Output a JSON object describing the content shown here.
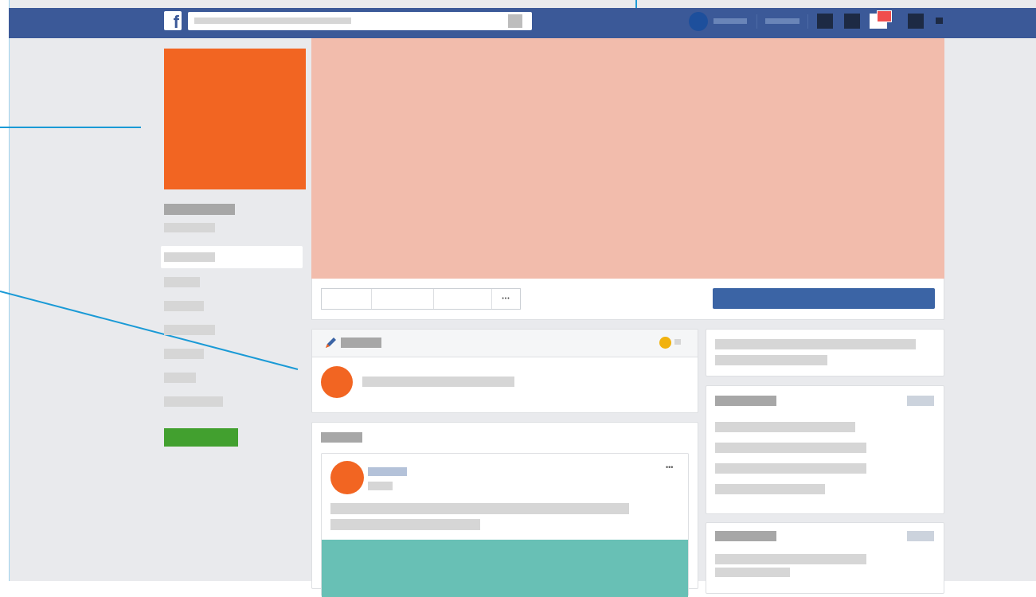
{
  "theme": {
    "brand_blue": "#3b5998",
    "primary_button": "#3b64a5",
    "profile_orange": "#f26522",
    "cover_peach": "#f2bcac",
    "post_teal": "#68c0b5",
    "green_button": "#42a02f",
    "notification_red": "#f04e4e",
    "status_yellow": "#f1b20f",
    "callout_line": "#1a9ad6"
  },
  "icons": {
    "logo": "facebook-logo",
    "search": "search-icon",
    "edit": "pencil-icon",
    "more": "more-dots-icon"
  },
  "labels": {
    "logo_letter": "f",
    "more_dots": "•••",
    "post_more_dots": "•••"
  }
}
